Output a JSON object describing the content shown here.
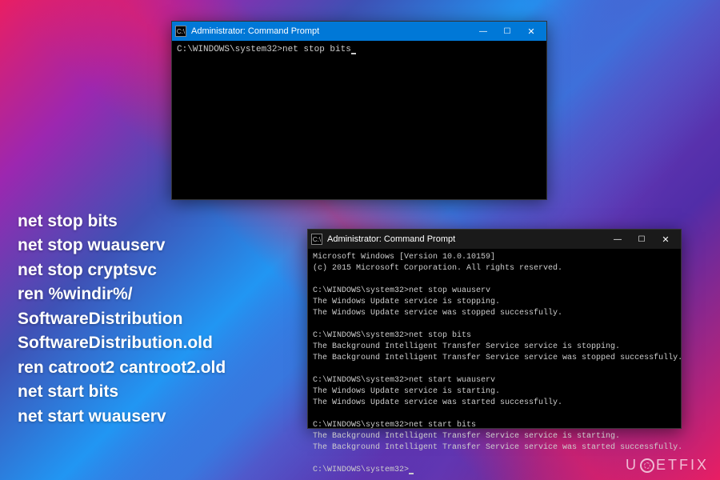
{
  "background": {
    "colors": [
      "#e91e63",
      "#9c27b0",
      "#3f51b5",
      "#2196f3",
      "#673ab7"
    ]
  },
  "window1": {
    "titlebar_icon": "C:\\",
    "title": "Administrator: Command Prompt",
    "body_line1": "C:\\WINDOWS\\system32>net stop bits"
  },
  "window2": {
    "titlebar_icon": "C:\\",
    "title": "Administrator: Command Prompt",
    "lines": {
      "l1": "Microsoft Windows [Version 10.0.10159]",
      "l2": "(c) 2015 Microsoft Corporation. All rights reserved.",
      "l3": "",
      "l4": "C:\\WINDOWS\\system32>net stop wuauserv",
      "l5": "The Windows Update service is stopping.",
      "l6": "The Windows Update service was stopped successfully.",
      "l7": "",
      "l8": "C:\\WINDOWS\\system32>net stop bits",
      "l9": "The Background Intelligent Transfer Service service is stopping.",
      "l10": "The Background Intelligent Transfer Service service was stopped successfully.",
      "l11": "",
      "l12": "C:\\WINDOWS\\system32>net start wuauserv",
      "l13": "The Windows Update service is starting.",
      "l14": "The Windows Update service was started successfully.",
      "l15": "",
      "l16": "C:\\WINDOWS\\system32>net start bits",
      "l17": "The Background Intelligent Transfer Service service is starting.",
      "l18": "The Background Intelligent Transfer Service service was started successfully.",
      "l19": "",
      "l20": "C:\\WINDOWS\\system32>"
    }
  },
  "overlay": {
    "l1": "net stop bits",
    "l2": "net stop wuauserv",
    "l3": "net stop cryptsvc",
    "l4": "ren %windir%/",
    "l5": "SoftwareDistribution",
    "l6": "SoftwareDistribution.old",
    "l7": "ren catroot2 cantroot2.old",
    "l8": "net start bits",
    "l9": "net start wuauserv"
  },
  "watermark": {
    "prefix": "U",
    "suffix": "ETFIX"
  }
}
